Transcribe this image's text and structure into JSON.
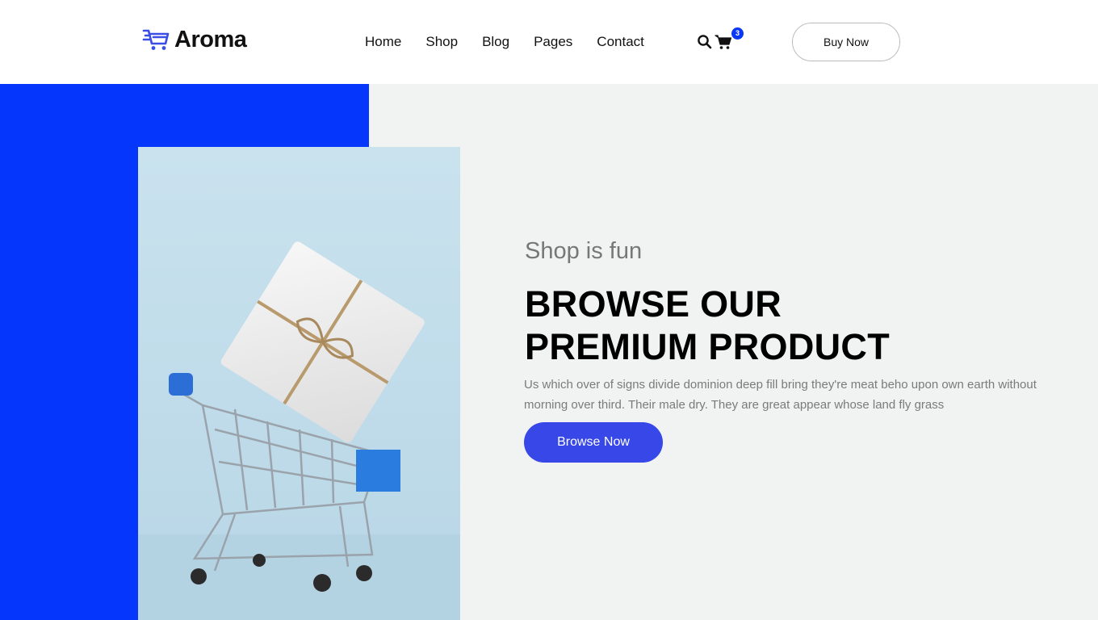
{
  "brand": {
    "name": "Aroma",
    "accent_color": "#0436fb",
    "logo_icon": "shopping-cart-lines-icon"
  },
  "nav": {
    "items": [
      {
        "label": "Home"
      },
      {
        "label": "Shop"
      },
      {
        "label": "Blog"
      },
      {
        "label": "Pages"
      },
      {
        "label": "Contact"
      }
    ]
  },
  "header_actions": {
    "search_icon": "search-icon",
    "cart_icon": "cart-icon",
    "cart_count": "3",
    "buy_now_label": "Buy Now"
  },
  "hero": {
    "subtitle": "Shop is fun",
    "title_line1": "BROWSE OUR",
    "title_line2": "PREMIUM PRODUCT",
    "description": "Us which over of signs divide dominion deep fill bring they're meat beho upon own earth without morning over third. Their male dry. They are great appear whose land fly grass",
    "cta_label": "Browse Now",
    "cta_color": "#3847e8",
    "image": "shopping-cart-with-gift-box-photo"
  }
}
